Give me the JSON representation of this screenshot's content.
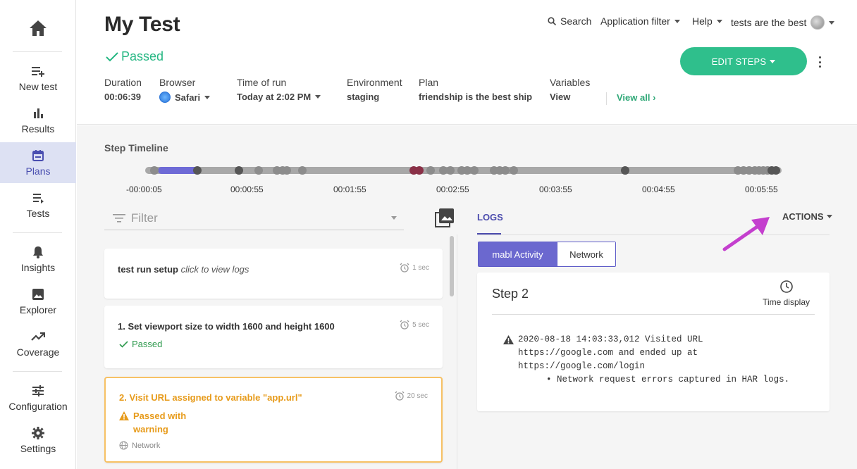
{
  "sidebar": {
    "home_label": "",
    "items": [
      {
        "label": "New test",
        "icon": "playlist-add-icon"
      },
      {
        "label": "Results",
        "icon": "bar-chart-icon"
      },
      {
        "label": "Plans",
        "icon": "calendar-icon",
        "active": true
      },
      {
        "label": "Tests",
        "icon": "list-icon"
      },
      {
        "label": "Insights",
        "icon": "bell-icon"
      },
      {
        "label": "Explorer",
        "icon": "image-icon"
      },
      {
        "label": "Coverage",
        "icon": "trending-up-icon"
      },
      {
        "label": "Configuration",
        "icon": "sliders-icon"
      },
      {
        "label": "Settings",
        "icon": "gear-icon"
      }
    ]
  },
  "header": {
    "title": "My Test",
    "status": "Passed",
    "topnav": {
      "search": "Search",
      "app_filter": "Application filter",
      "help": "Help",
      "workspace": "tests are the best"
    },
    "edit_steps": "EDIT STEPS",
    "meta": [
      {
        "key": "Duration",
        "value": "00:06:39"
      },
      {
        "key": "Browser",
        "value": "Safari"
      },
      {
        "key": "Time of run",
        "value": "Today at 2:02 PM"
      },
      {
        "key": "Environment",
        "value": "staging"
      },
      {
        "key": "Plan",
        "value": "friendship is the best ship"
      },
      {
        "key": "Variables",
        "value": "View"
      }
    ],
    "view_all": "View all"
  },
  "timeline": {
    "title": "Step Timeline",
    "ticks": [
      "-00:00:05",
      "00:00:55",
      "00:01:55",
      "00:02:55",
      "00:03:55",
      "00:04:55",
      "00:05:55"
    ]
  },
  "filter": {
    "placeholder": "Filter"
  },
  "steps": [
    {
      "title": "test run setup",
      "hint": "click to view logs",
      "duration": "1 sec"
    },
    {
      "title": "1. Set viewport size to width 1600 and height 1600",
      "duration": "5 sec",
      "status": "Passed"
    },
    {
      "title": "2. Visit URL assigned to variable \"app.url\"",
      "duration": "20 sec",
      "status_line1": "Passed with",
      "status_line2": "warning",
      "tag": "Network"
    }
  ],
  "logs": {
    "tab": "LOGS",
    "actions": "ACTIONS",
    "seg_active": "mabl Activity",
    "seg_other": "Network",
    "step_title": "Step 2",
    "time_display": "Time display",
    "lines": [
      "2020-08-18 14:03:33,012 Visited URL",
      "https://google.com and ended up at",
      "https://google.com/login"
    ],
    "bullet": "Network request errors captured in HAR logs."
  },
  "colors": {
    "accent": "#2fbf8c",
    "primary": "#6b68cf",
    "warning": "#e79b1b",
    "annotation_arrow": "#c43fce"
  }
}
